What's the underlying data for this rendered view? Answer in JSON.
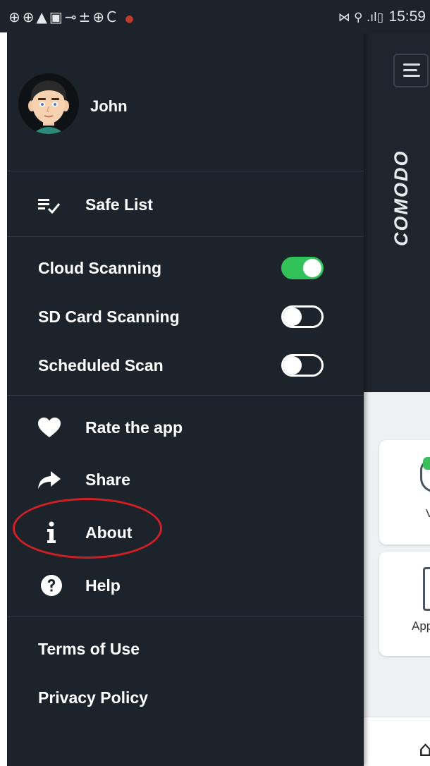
{
  "status_bar": {
    "left_icons": "⊕⊕▲▣⊸±⊕C",
    "right_icons": "⋈ ⚲ .ıl▯",
    "time": "15:59"
  },
  "app": {
    "brand": "COMODO",
    "card_labels": [
      "V",
      "App"
    ]
  },
  "drawer": {
    "user_name": "John",
    "safe_list_label": "Safe List",
    "toggles": [
      {
        "label": "Cloud Scanning",
        "state": "on"
      },
      {
        "label": "SD Card Scanning",
        "state": "off"
      },
      {
        "label": "Scheduled Scan",
        "state": "off"
      }
    ],
    "menu": [
      {
        "label": "Rate the app",
        "icon": "heart-icon"
      },
      {
        "label": "Share",
        "icon": "share-arrow-icon"
      },
      {
        "label": "About",
        "icon": "info-icon"
      },
      {
        "label": "Help",
        "icon": "help-circle-icon"
      }
    ],
    "footer_links": [
      "Terms of Use",
      "Privacy Policy"
    ]
  },
  "colors": {
    "drawer_bg": "#1d232a",
    "toggle_on": "#31c25a",
    "highlight_ring": "#d01f25"
  }
}
